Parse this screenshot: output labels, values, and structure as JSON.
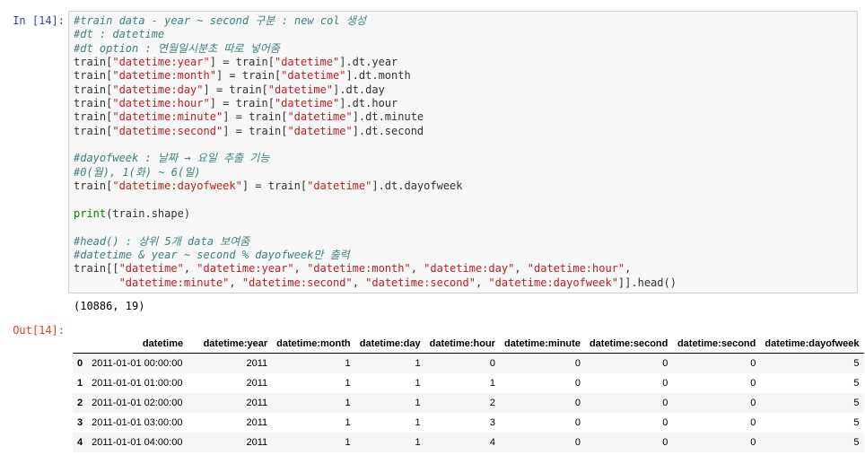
{
  "cell": {
    "in_prompt": "In [14]:",
    "out_prompt": "Out[14]:",
    "code_lines": [
      [
        {
          "t": "#train data - year ~ second 구분 : new col 생성",
          "c": "cm"
        }
      ],
      [
        {
          "t": "#dt : datetime",
          "c": "cm"
        }
      ],
      [
        {
          "t": "#dt option : 연월일시분초 따로 넣어줌",
          "c": "cm"
        }
      ],
      [
        {
          "t": "train["
        },
        {
          "t": "\"datetime:year\"",
          "c": "st"
        },
        {
          "t": "] = train["
        },
        {
          "t": "\"datetime\"",
          "c": "st"
        },
        {
          "t": "].dt.year"
        }
      ],
      [
        {
          "t": "train["
        },
        {
          "t": "\"datetime:month\"",
          "c": "st"
        },
        {
          "t": "] = train["
        },
        {
          "t": "\"datetime\"",
          "c": "st"
        },
        {
          "t": "].dt.month"
        }
      ],
      [
        {
          "t": "train["
        },
        {
          "t": "\"datetime:day\"",
          "c": "st"
        },
        {
          "t": "] = train["
        },
        {
          "t": "\"datetime\"",
          "c": "st"
        },
        {
          "t": "].dt.day"
        }
      ],
      [
        {
          "t": "train["
        },
        {
          "t": "\"datetime:hour\"",
          "c": "st"
        },
        {
          "t": "] = train["
        },
        {
          "t": "\"datetime\"",
          "c": "st"
        },
        {
          "t": "].dt.hour"
        }
      ],
      [
        {
          "t": "train["
        },
        {
          "t": "\"datetime:minute\"",
          "c": "st"
        },
        {
          "t": "] = train["
        },
        {
          "t": "\"datetime\"",
          "c": "st"
        },
        {
          "t": "].dt.minute"
        }
      ],
      [
        {
          "t": "train["
        },
        {
          "t": "\"datetime:second\"",
          "c": "st"
        },
        {
          "t": "] = train["
        },
        {
          "t": "\"datetime\"",
          "c": "st"
        },
        {
          "t": "].dt.second"
        }
      ],
      [],
      [
        {
          "t": "#dayofweek : 날짜 → 요일 추출 기능",
          "c": "cm"
        }
      ],
      [
        {
          "t": "#0(월), 1(화) ~ 6(일)",
          "c": "cm"
        }
      ],
      [
        {
          "t": "train["
        },
        {
          "t": "\"datetime:dayofweek\"",
          "c": "st"
        },
        {
          "t": "] = train["
        },
        {
          "t": "\"datetime\"",
          "c": "st"
        },
        {
          "t": "].dt.dayofweek"
        }
      ],
      [],
      [
        {
          "t": "print",
          "c": "bi"
        },
        {
          "t": "(train.shape)"
        }
      ],
      [],
      [
        {
          "t": "#head() : 상위 5개 data 보여줌",
          "c": "cm"
        }
      ],
      [
        {
          "t": "#datetime & year ~ second % dayofweek만 출력",
          "c": "cm"
        }
      ],
      [
        {
          "t": "train[["
        },
        {
          "t": "\"datetime\"",
          "c": "st"
        },
        {
          "t": ", "
        },
        {
          "t": "\"datetime:year\"",
          "c": "st"
        },
        {
          "t": ", "
        },
        {
          "t": "\"datetime:month\"",
          "c": "st"
        },
        {
          "t": ", "
        },
        {
          "t": "\"datetime:day\"",
          "c": "st"
        },
        {
          "t": ", "
        },
        {
          "t": "\"datetime:hour\"",
          "c": "st"
        },
        {
          "t": ","
        }
      ],
      [
        {
          "t": "       "
        },
        {
          "t": "\"datetime:minute\"",
          "c": "st"
        },
        {
          "t": ", "
        },
        {
          "t": "\"datetime:second\"",
          "c": "st"
        },
        {
          "t": ", "
        },
        {
          "t": "\"datetime:second\"",
          "c": "st"
        },
        {
          "t": ", "
        },
        {
          "t": "\"datetime:dayofweek\"",
          "c": "st"
        },
        {
          "t": "]].head()"
        }
      ]
    ],
    "stdout": "(10886, 19)"
  },
  "dataframe": {
    "columns": [
      "",
      "datetime",
      "datetime:year",
      "datetime:month",
      "datetime:day",
      "datetime:hour",
      "datetime:minute",
      "datetime:second",
      "datetime:second",
      "datetime:dayofweek"
    ],
    "rows": [
      [
        "0",
        "2011-01-01 00:00:00",
        "2011",
        "1",
        "1",
        "0",
        "0",
        "0",
        "0",
        "5"
      ],
      [
        "1",
        "2011-01-01 01:00:00",
        "2011",
        "1",
        "1",
        "1",
        "0",
        "0",
        "0",
        "5"
      ],
      [
        "2",
        "2011-01-01 02:00:00",
        "2011",
        "1",
        "1",
        "2",
        "0",
        "0",
        "0",
        "5"
      ],
      [
        "3",
        "2011-01-01 03:00:00",
        "2011",
        "1",
        "1",
        "3",
        "0",
        "0",
        "0",
        "5"
      ],
      [
        "4",
        "2011-01-01 04:00:00",
        "2011",
        "1",
        "1",
        "4",
        "0",
        "0",
        "0",
        "5"
      ]
    ]
  }
}
